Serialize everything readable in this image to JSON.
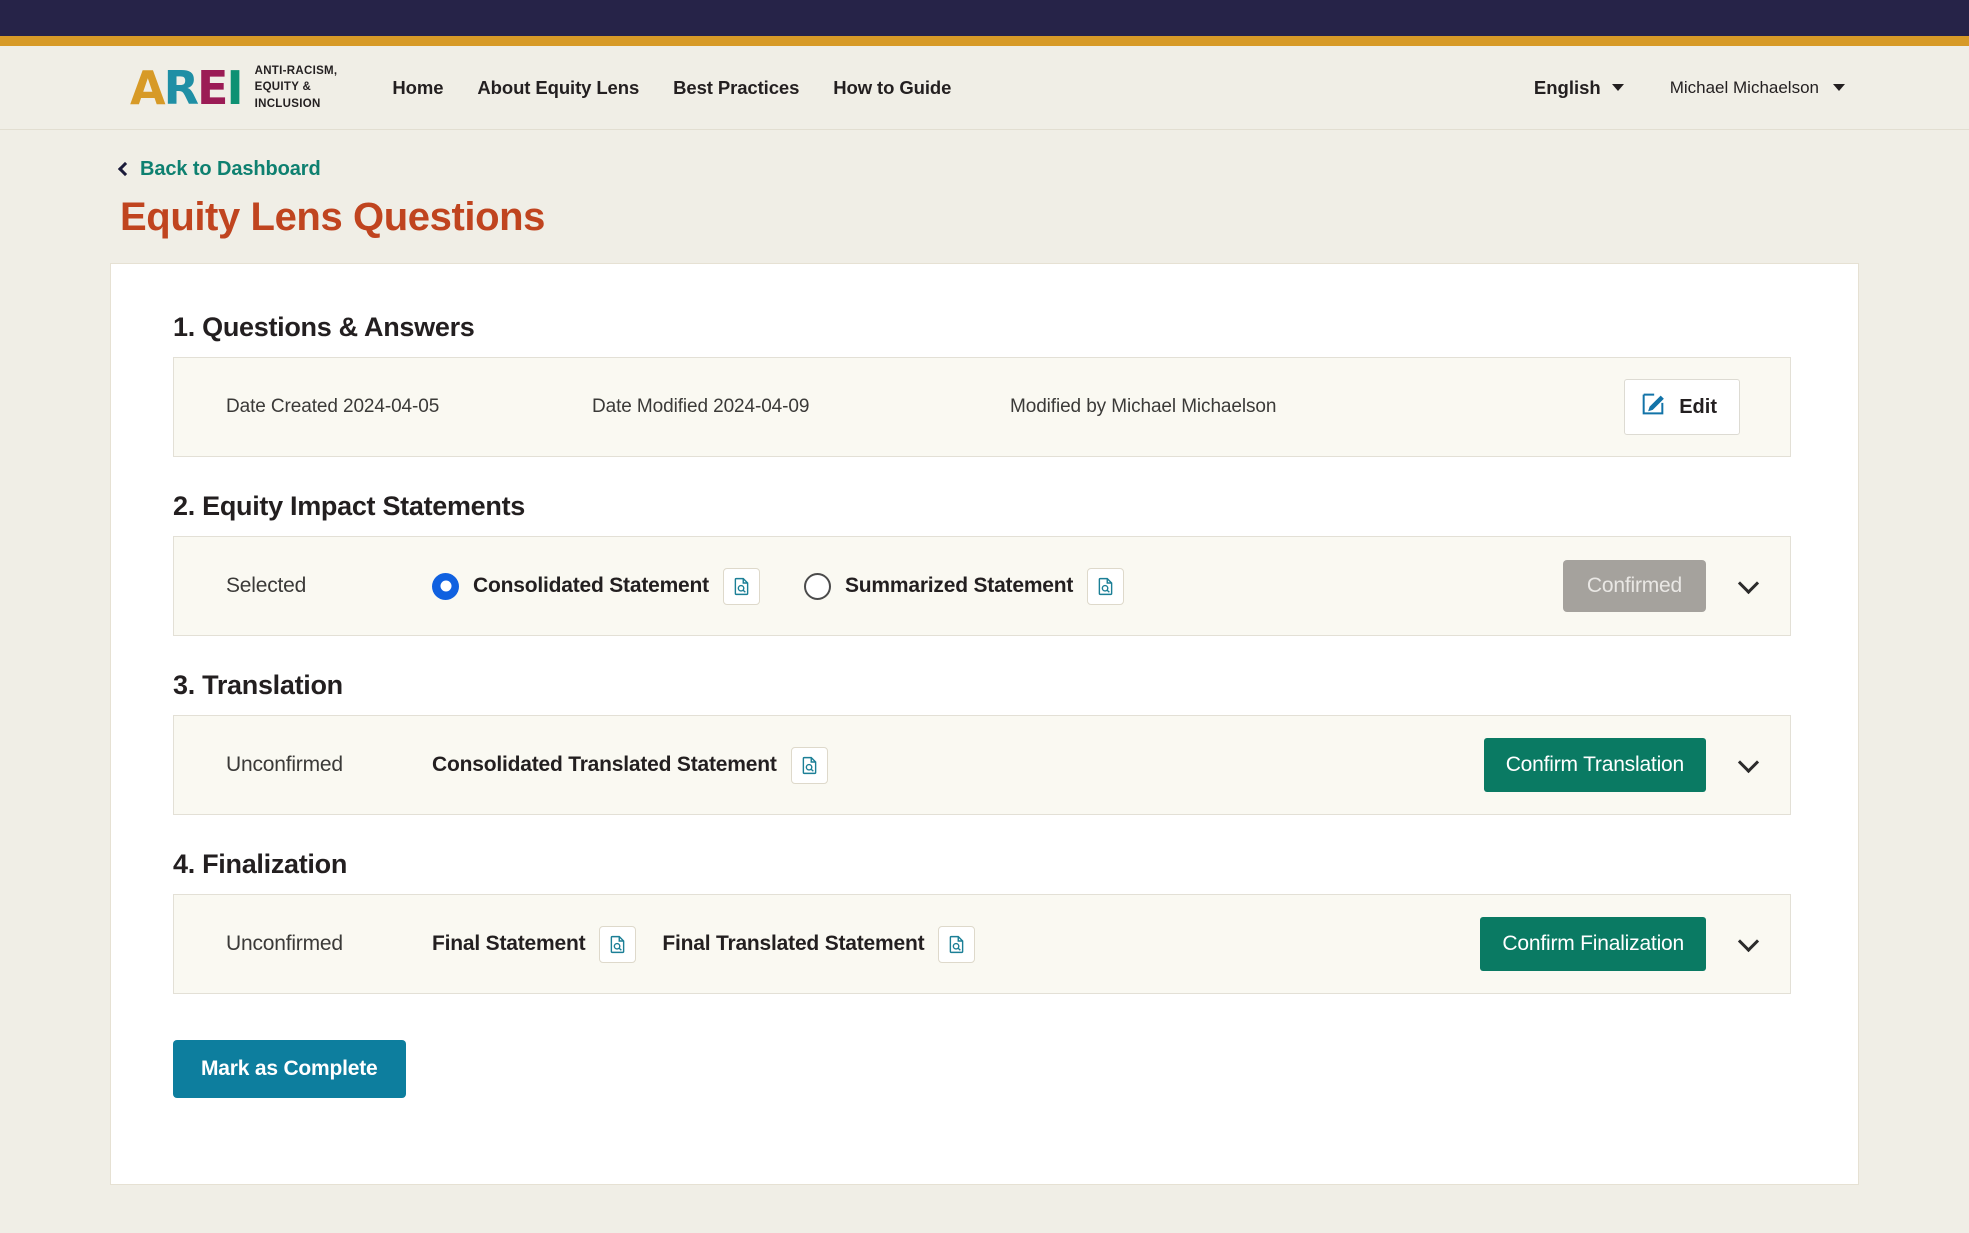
{
  "header": {
    "logo": {
      "letters": [
        "A",
        "R",
        "E",
        "I"
      ],
      "tagline_lines": [
        "ANTI-RACISM,",
        "EQUITY &",
        "INCLUSION"
      ],
      "colors": {
        "a": "#d79a27",
        "r": "#1f8fa5",
        "e": "#9b1b55",
        "i": "#0e9173"
      }
    },
    "nav": [
      {
        "label": "Home"
      },
      {
        "label": "About Equity Lens"
      },
      {
        "label": "Best Practices"
      },
      {
        "label": "How to Guide"
      }
    ],
    "language": "English",
    "user": "Michael Michaelson"
  },
  "page": {
    "back_link": "Back to Dashboard",
    "title": "Equity Lens Questions",
    "title_color": "#c0441f",
    "back_link_color": "#0e8070"
  },
  "sections": {
    "questions_answers": {
      "heading": "1. Questions & Answers",
      "date_created": "Date Created 2024-04-05",
      "date_modified": "Date Modified 2024-04-09",
      "modified_by": "Modified by Michael Michaelson",
      "edit_label": "Edit"
    },
    "equity_impact": {
      "heading": "2. Equity Impact Statements",
      "status": "Selected",
      "options": [
        {
          "label": "Consolidated Statement",
          "selected": true
        },
        {
          "label": "Summarized Statement",
          "selected": false
        }
      ],
      "action_label": "Confirmed",
      "action_state": "disabled",
      "action_color": "#a5a29d"
    },
    "translation": {
      "heading": "3. Translation",
      "status": "Unconfirmed",
      "documents": [
        {
          "label": "Consolidated Translated Statement"
        }
      ],
      "action_label": "Confirm Translation",
      "action_color": "#0a7a63"
    },
    "finalization": {
      "heading": "4. Finalization",
      "status": "Unconfirmed",
      "documents": [
        {
          "label": "Final Statement"
        },
        {
          "label": "Final Translated Statement"
        }
      ],
      "action_label": "Confirm Finalization",
      "action_color": "#0a7a63"
    }
  },
  "footer_action": {
    "label": "Mark as Complete",
    "color": "#0d7e9e"
  }
}
